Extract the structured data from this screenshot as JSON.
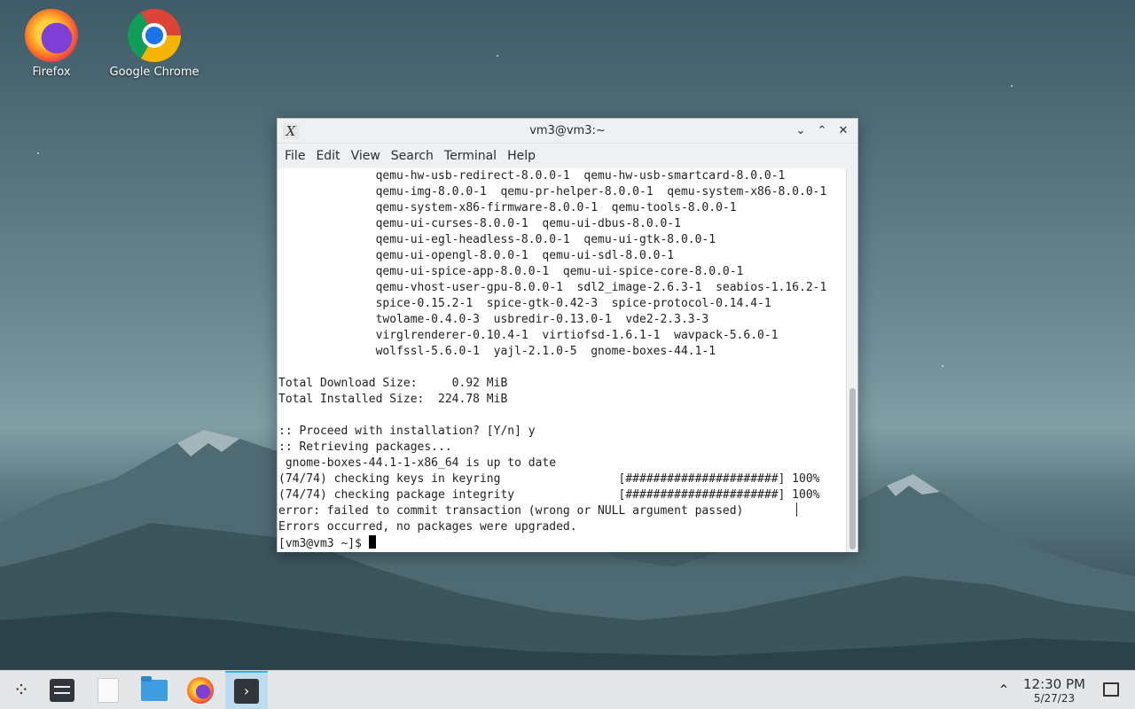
{
  "desktop": {
    "icons": [
      {
        "label": "Firefox",
        "icon": "firefox-icon"
      },
      {
        "label": "Google Chrome",
        "icon": "chrome-icon"
      }
    ]
  },
  "window": {
    "title": "vm3@vm3:~",
    "app_icon": "X",
    "controls": {
      "minimize": "⌄",
      "maximize": "⌃",
      "close": "✕"
    },
    "menu": [
      "File",
      "Edit",
      "View",
      "Search",
      "Terminal",
      "Help"
    ]
  },
  "terminal": {
    "lines": [
      "              qemu-hw-usb-redirect-8.0.0-1  qemu-hw-usb-smartcard-8.0.0-1",
      "              qemu-img-8.0.0-1  qemu-pr-helper-8.0.0-1  qemu-system-x86-8.0.0-1",
      "              qemu-system-x86-firmware-8.0.0-1  qemu-tools-8.0.0-1",
      "              qemu-ui-curses-8.0.0-1  qemu-ui-dbus-8.0.0-1",
      "              qemu-ui-egl-headless-8.0.0-1  qemu-ui-gtk-8.0.0-1",
      "              qemu-ui-opengl-8.0.0-1  qemu-ui-sdl-8.0.0-1",
      "              qemu-ui-spice-app-8.0.0-1  qemu-ui-spice-core-8.0.0-1",
      "              qemu-vhost-user-gpu-8.0.0-1  sdl2_image-2.6.3-1  seabios-1.16.2-1",
      "              spice-0.15.2-1  spice-gtk-0.42-3  spice-protocol-0.14.4-1",
      "              twolame-0.4.0-3  usbredir-0.13.0-1  vde2-2.3.3-3",
      "              virglrenderer-0.10.4-1  virtiofsd-1.6.1-1  wavpack-5.6.0-1",
      "              wolfssl-5.6.0-1  yajl-2.1.0-5  gnome-boxes-44.1-1",
      "",
      "Total Download Size:     0.92 MiB",
      "Total Installed Size:  224.78 MiB",
      "",
      ":: Proceed with installation? [Y/n] y",
      ":: Retrieving packages...",
      " gnome-boxes-44.1-1-x86_64 is up to date",
      "(74/74) checking keys in keyring                 [######################] 100%",
      "(74/74) checking package integrity               [######################] 100%",
      "error: failed to commit transaction (wrong or NULL argument passed)",
      "Errors occurred, no packages were upgraded."
    ],
    "prompt": "[vm3@vm3 ~]$ "
  },
  "taskbar": {
    "items": [
      {
        "name": "application-launcher-icon",
        "active": false
      },
      {
        "name": "system-settings-icon",
        "active": false
      },
      {
        "name": "text-editor-icon",
        "active": false
      },
      {
        "name": "file-manager-icon",
        "active": false
      },
      {
        "name": "firefox-icon",
        "active": false
      },
      {
        "name": "terminal-icon",
        "active": true
      }
    ],
    "tray_arrow": "⌃",
    "clock": {
      "time": "12:30 PM",
      "date": "5/27/23"
    }
  }
}
